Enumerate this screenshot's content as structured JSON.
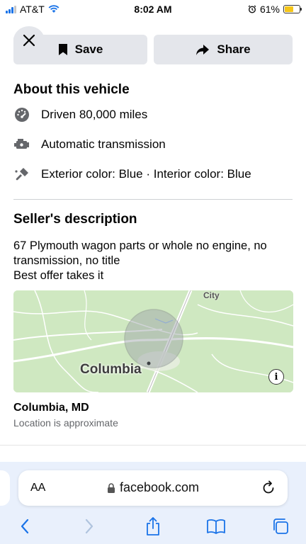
{
  "status_bar": {
    "carrier": "AT&T",
    "time": "8:02 AM",
    "battery": "61%"
  },
  "actions": {
    "save_label": "Save",
    "share_label": "Share"
  },
  "about": {
    "title": "About this vehicle",
    "specs": [
      {
        "icon": "speedometer-icon",
        "text": "Driven 80,000 miles"
      },
      {
        "icon": "engine-icon",
        "text": "Automatic transmission"
      },
      {
        "icon": "paint-brush-icon",
        "text": "Exterior color: Blue · Interior color: Blue"
      }
    ]
  },
  "seller": {
    "title": "Seller's description",
    "description": "67 Plymouth wagon parts or whole no engine, no transmission, no title\nBest offer takes it"
  },
  "map": {
    "city_label": "Columbia",
    "small_label": "City",
    "info_symbol": "i"
  },
  "location": {
    "city": "Columbia, MD",
    "note": "Location is approximate"
  },
  "browser": {
    "aa_label": "AA",
    "url": "facebook.com"
  },
  "colors": {
    "accent": "#1a73e8",
    "button_bg": "#e4e6eb",
    "safari_bg": "#e9f0fc",
    "map_green": "#cfe8c1"
  }
}
